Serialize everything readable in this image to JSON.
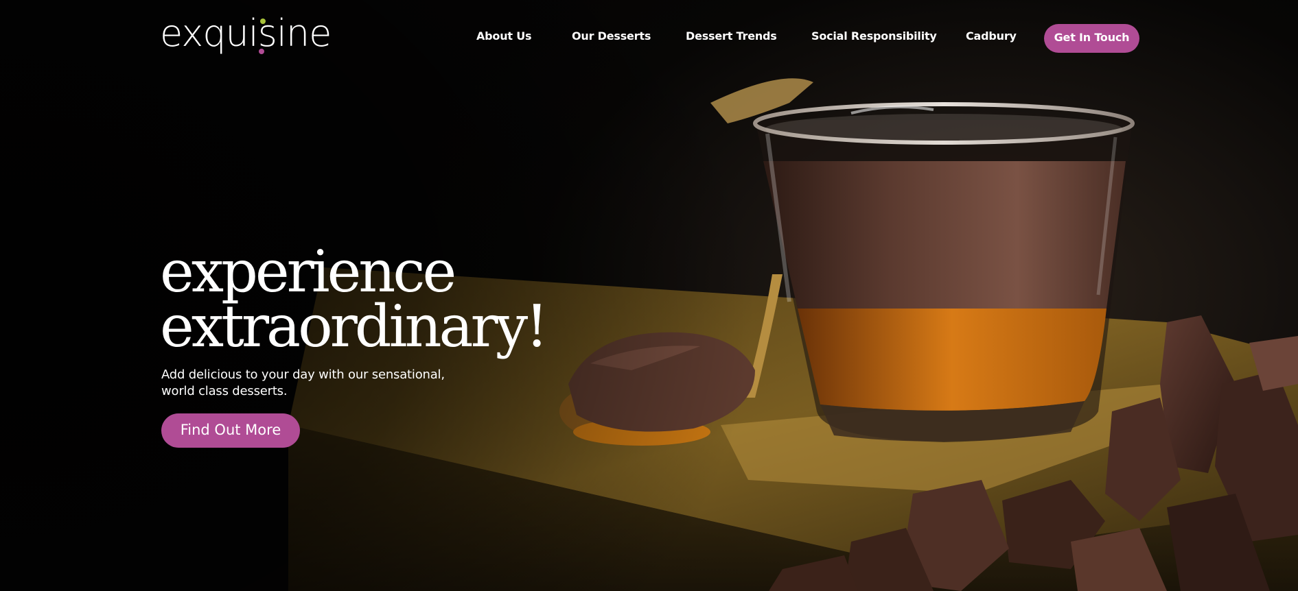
{
  "brand": {
    "logo_text": "exquisine",
    "accent": "#b04c95",
    "logo_dot_colors": [
      "#a8c23a",
      "#b04c95"
    ]
  },
  "nav": {
    "items": [
      {
        "label": "About Us"
      },
      {
        "label": "Our Desserts"
      },
      {
        "label": "Dessert Trends"
      },
      {
        "label": "Social Responsibility"
      },
      {
        "label": "Cadbury"
      }
    ],
    "cta_label": "Get In Touch"
  },
  "hero": {
    "title_line1": "experience",
    "title_line2": "extraordinary!",
    "subtitle": "Add delicious to your day with our sensational, world class desserts.",
    "cta_label": "Find Out More",
    "image_icon": "chocolate-mousse-dessert-photo"
  }
}
